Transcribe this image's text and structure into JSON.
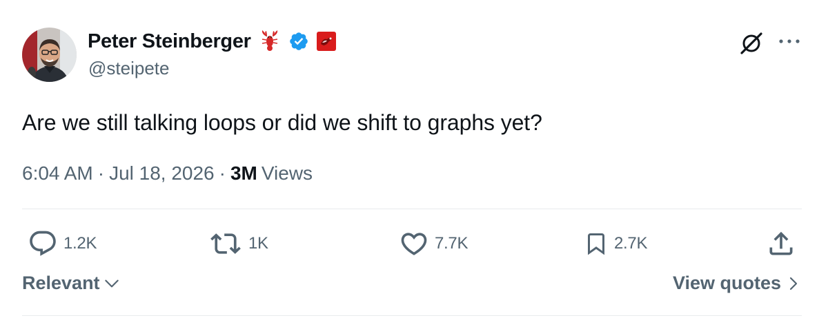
{
  "author": {
    "display_name": "Peter Steinberger",
    "handle": "@steipete",
    "verified": true,
    "avatar_icon": "profile-photo",
    "badge_icons": [
      "lobster-emoji",
      "verified-badge-icon",
      "affiliate-badge-icon"
    ]
  },
  "header_actions": {
    "grok_icon": "grok-icon",
    "more_icon": "more-icon"
  },
  "tweet": {
    "text": "Are we still talking loops or did we shift to graphs yet?"
  },
  "meta": {
    "time": "6:04 AM",
    "separator": "·",
    "date": "Jul 18, 2026",
    "views_count": "3M",
    "views_label": "Views"
  },
  "engagement": {
    "replies": {
      "icon": "reply-icon",
      "count": "1.2K"
    },
    "reposts": {
      "icon": "repost-icon",
      "count": "1K"
    },
    "likes": {
      "icon": "heart-icon",
      "count": "7.7K"
    },
    "bookmarks": {
      "icon": "bookmark-icon",
      "count": "2.7K"
    },
    "share": {
      "icon": "share-icon"
    }
  },
  "replies_sort": {
    "label": "Relevant"
  },
  "quotes_link": {
    "label": "View quotes"
  },
  "colors": {
    "text_primary": "#0f1419",
    "text_secondary": "#536471",
    "verified_blue": "#1d9bf0",
    "divider": "#eff3f4"
  }
}
